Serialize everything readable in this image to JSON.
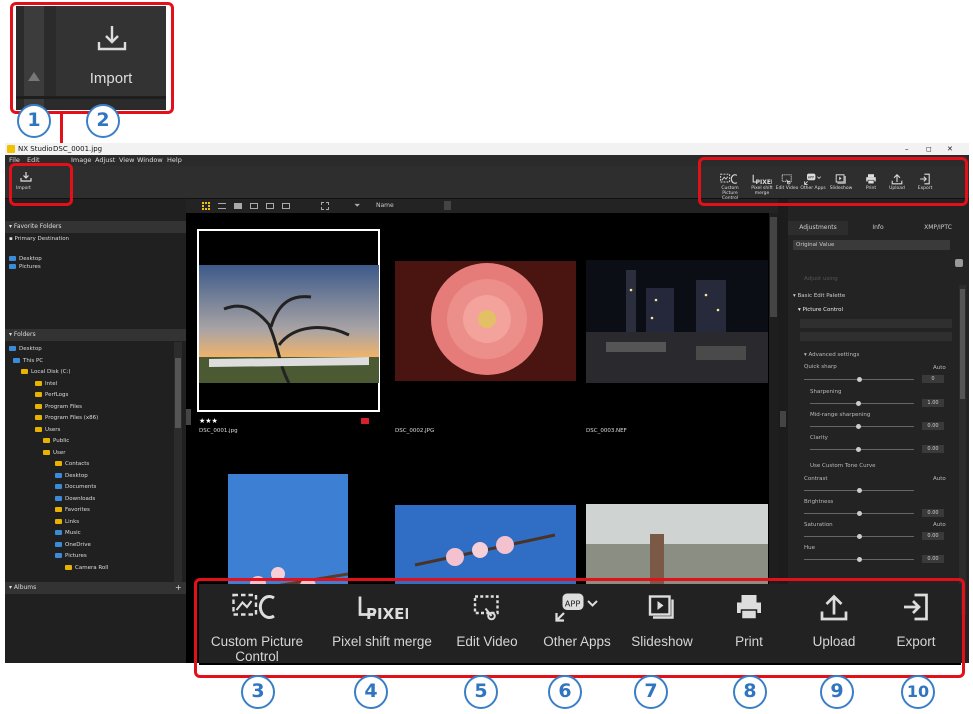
{
  "import_zoom": {
    "label": "Import"
  },
  "window": {
    "app_title": "NX Studio",
    "file_title": "DSC_0001.jpg",
    "menu": [
      "File",
      "Edit",
      "Image",
      "Adjust",
      "View",
      "Window",
      "Help"
    ],
    "controls": [
      "–",
      "◻",
      "✕"
    ],
    "import_label": "Import",
    "toolbar": [
      {
        "label": "Custom Picture Control",
        "icon": "custom-picture-control-icon"
      },
      {
        "label": "Pixel shift merge",
        "icon": "pixel-shift-icon"
      },
      {
        "label": "Edit Video",
        "icon": "edit-video-icon"
      },
      {
        "label": "Other Apps",
        "icon": "other-apps-icon"
      },
      {
        "label": "Slideshow",
        "icon": "slideshow-icon"
      },
      {
        "label": "Print",
        "icon": "print-icon"
      },
      {
        "label": "Upload",
        "icon": "upload-icon"
      },
      {
        "label": "Export",
        "icon": "export-icon"
      }
    ]
  },
  "sidebar": {
    "favorites_header": "Favorite Folders",
    "primary_destination": "Primary Destination",
    "favorites": [
      "Desktop",
      "Pictures"
    ],
    "folders_header": "Folders",
    "tree": [
      "Desktop",
      "This PC",
      "Local Disk (C:)",
      "Intel",
      "PerfLogs",
      "Program Files",
      "Program Files (x86)",
      "Users",
      "Public",
      "User",
      "Contacts",
      "Desktop",
      "Documents",
      "Downloads",
      "Favorites",
      "Links",
      "Music",
      "OneDrive",
      "Pictures",
      "Camera Roll"
    ],
    "albums_header": "Albums",
    "albums_add": "+"
  },
  "browser": {
    "sort_label": "Name",
    "thumbnails": [
      {
        "name": "DSC_0001.jpg",
        "rating": "★★★",
        "selected": true
      },
      {
        "name": "DSC_0002.JPG",
        "rating": "",
        "selected": false
      },
      {
        "name": "DSC_0003.NEF",
        "rating": "",
        "selected": false
      }
    ]
  },
  "adjust_panel": {
    "tabs": [
      "Adjustments",
      "Info",
      "XMP/IPTC"
    ],
    "preset": "Original Value",
    "adjust_using": "Adjust using",
    "palette_header": "Basic Edit Palette",
    "picture_control": "Picture Control",
    "advanced": "Advanced settings",
    "quick_sharp": "Quick sharp",
    "sharpening": "Sharpening",
    "midrange": "Mid-range sharpening",
    "clarity": "Clarity",
    "use_custom_curve": "Use Custom Tone Curve",
    "contrast": "Contrast",
    "brightness": "Brightness",
    "saturation": "Saturation",
    "hue": "Hue",
    "auto": "Auto",
    "values": [
      "0",
      "1.00",
      "0.00",
      "0.00",
      "0.00",
      "0.00",
      "0.00"
    ]
  },
  "zoom_toolbar": {
    "items": [
      {
        "label": "Custom Picture\nControl",
        "icon": "custom-picture-control-icon"
      },
      {
        "label": "Pixel shift merge",
        "icon": "pixel-shift-icon"
      },
      {
        "label": "Edit Video",
        "icon": "edit-video-icon"
      },
      {
        "label": "Other Apps",
        "icon": "other-apps-icon"
      },
      {
        "label": "Slideshow",
        "icon": "slideshow-icon"
      },
      {
        "label": "Print",
        "icon": "print-icon"
      },
      {
        "label": "Upload",
        "icon": "upload-icon"
      },
      {
        "label": "Export",
        "icon": "export-icon"
      }
    ]
  },
  "callouts": [
    "1",
    "2",
    "3",
    "4",
    "5",
    "6",
    "7",
    "8",
    "9",
    "10"
  ],
  "colors": {
    "callout_red": "#e3101a",
    "callout_blue": "#3a7fc6",
    "accent_yellow": "#f2c200"
  }
}
